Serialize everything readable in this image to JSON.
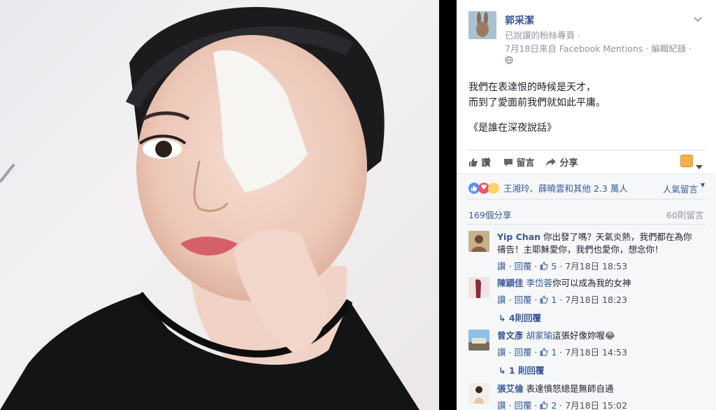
{
  "post": {
    "author": "郭采潔",
    "subtitle": "已說讚的粉絲專頁 ·",
    "meta": "7月18日來自 Facebook Mentions · 編輯紀錄 ·",
    "text_line1": "我們在表達恨的時候是天才，",
    "text_line2": "而到了愛面前我們就如此平庸。",
    "text_line3": "《是誰在深夜說話》"
  },
  "actions": {
    "like": "讚",
    "comment": "留言",
    "share": "分享"
  },
  "reactions": {
    "summary": "王湘玲、薛曉雲和其他 2.3 萬人",
    "sort": "人氣留言"
  },
  "stats": {
    "shares": "169個分享",
    "comments": "60則留言"
  },
  "comments": [
    {
      "name": "Yip Chan",
      "text_a": "你出發了嗎？天氣炎熱，我們都在為你",
      "text_b": "禱告！主耶穌愛你，我們也愛你，想念你！",
      "like": "讚",
      "reply": "回覆",
      "count": "5",
      "time": "7月18日 18:53"
    },
    {
      "name": "陳穎佳",
      "tag": "李岱蓉",
      "text_a": "你可以成為我的女神",
      "like": "讚",
      "reply": "回覆",
      "count": "1",
      "time": "7月18日 18:23",
      "replies": "4則回覆"
    },
    {
      "name": "曾文彥",
      "tag": "胡家瑜",
      "text_a": "這張好像妳喔😂",
      "like": "讚",
      "reply": "回覆",
      "count": "1",
      "time": "7月18日 14:53",
      "replies": "1 則回覆"
    },
    {
      "name": "張艾倫",
      "text_a": "表達憤怒總是無師自通",
      "like": "讚",
      "reply": "回覆",
      "count": "2",
      "time": "7月18日 15:02"
    }
  ],
  "colors": {
    "link": "#365899",
    "muted": "#90949c",
    "like_blue": "#5890ff"
  }
}
